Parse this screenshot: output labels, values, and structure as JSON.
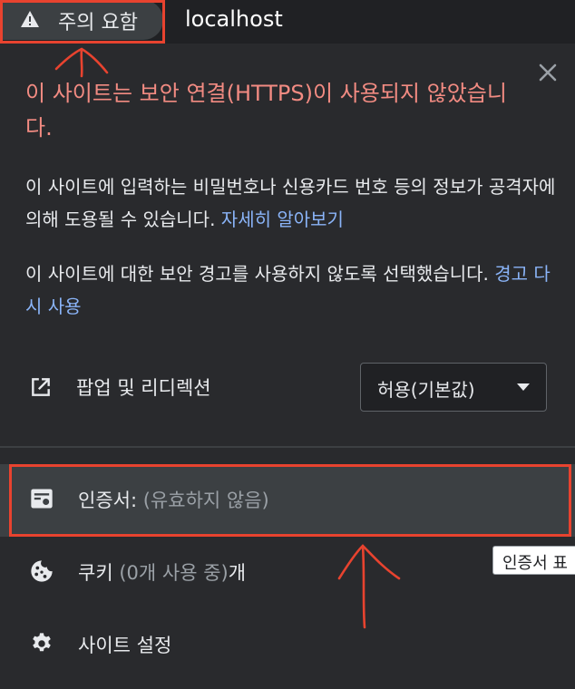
{
  "address_bar": {
    "security_chip_label": "주의 요함",
    "host": "localhost"
  },
  "popup": {
    "title": "이 사이트는 보안 연결(HTTPS)이 사용되지 않았습니다.",
    "warning_text": "이 사이트에 입력하는 비밀번호나 신용카드 번호 등의 정보가 공격자에 의해 도용될 수 있습니다.",
    "learn_more_link": "자세히 알아보기",
    "disabled_text": "이 사이트에 대한 보안 경고를 사용하지 않도록 선택했습니다.",
    "reenable_link": "경고 다시 사용",
    "permissions": [
      {
        "label": "팝업 및 리디렉션",
        "value": "허용(기본값)",
        "icon": "open-in-new-icon"
      }
    ],
    "certificate": {
      "label": "인증서:",
      "status": "(유효하지 않음)",
      "icon": "certificate-icon"
    },
    "cookies": {
      "label": "쿠키",
      "count_text": "(0개 사용 중)",
      "suffix": "개",
      "icon": "cookie-icon"
    },
    "site_settings": {
      "label": "사이트 설정",
      "icon": "gear-icon"
    },
    "tooltip": "인증서 표"
  },
  "colors": {
    "background": "#202124",
    "panel": "#292a2d",
    "title_red": "#f28b82",
    "link_blue": "#8ab4f8",
    "annotation_red": "#e8432f"
  }
}
